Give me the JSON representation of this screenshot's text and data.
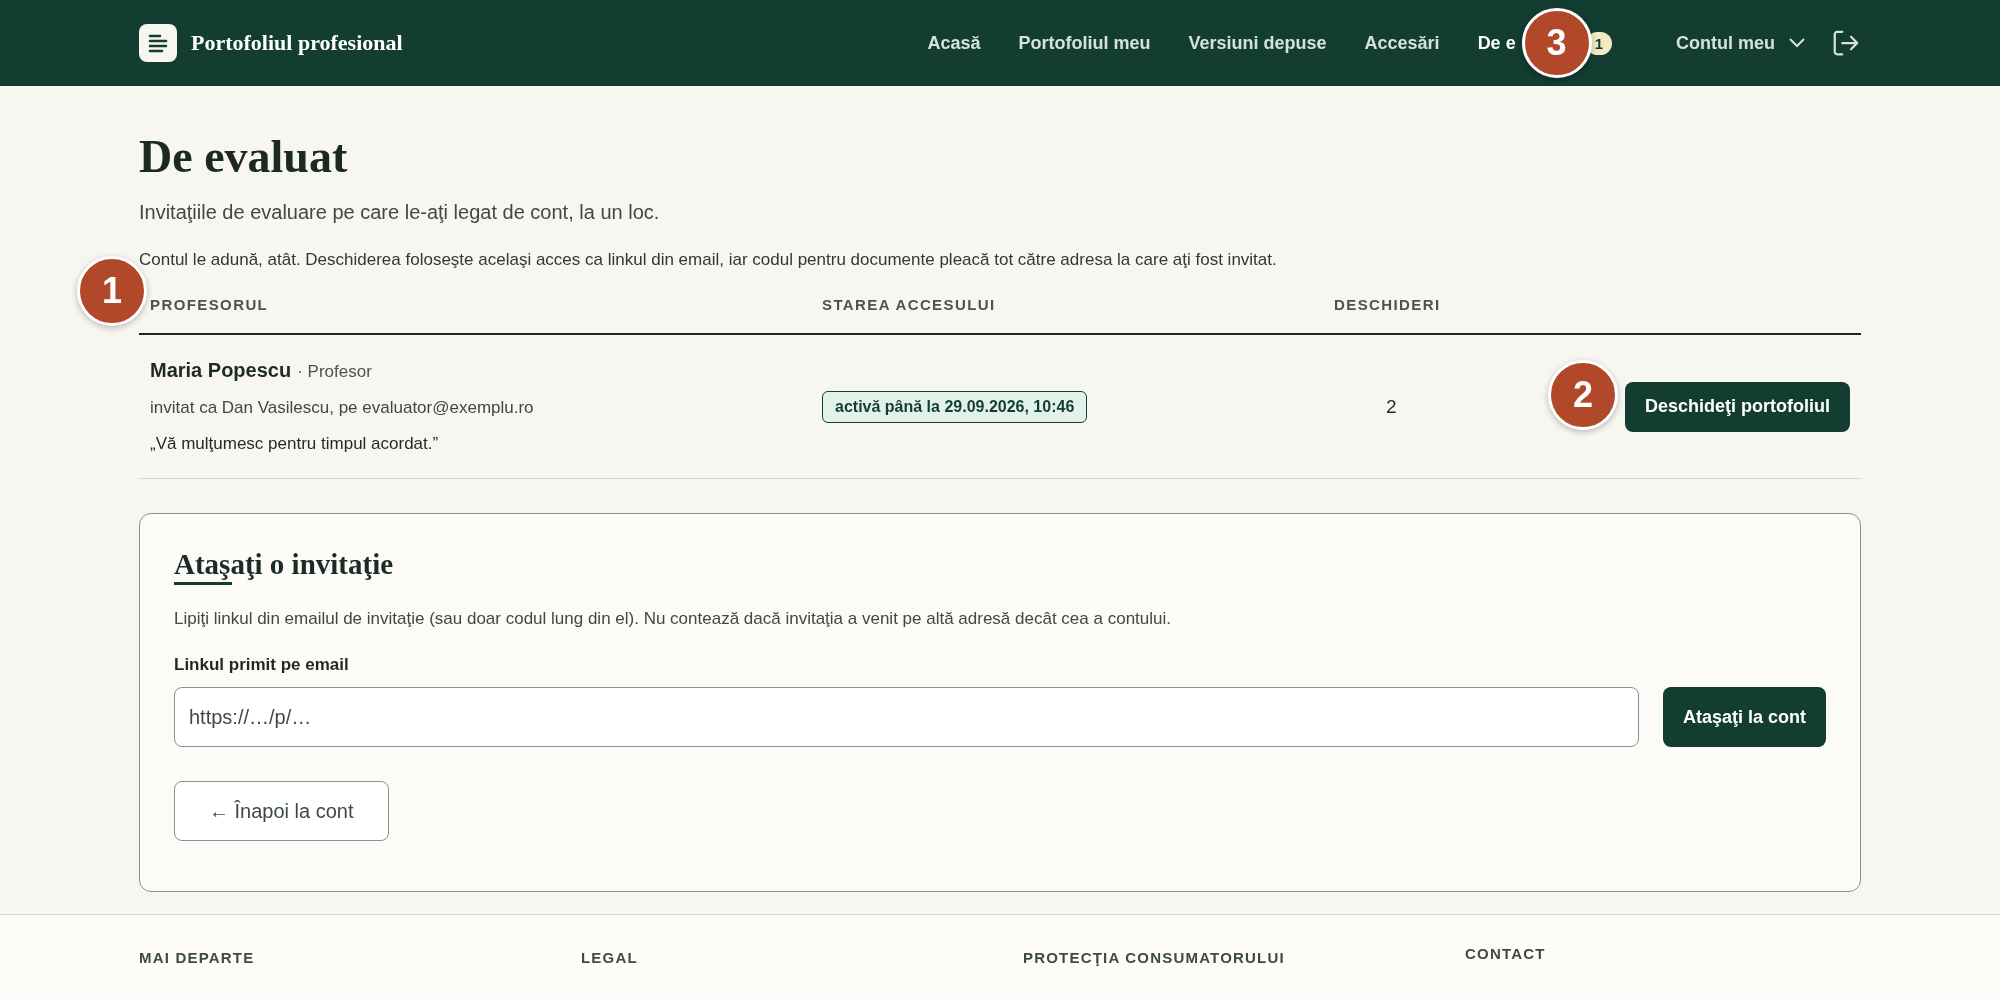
{
  "header": {
    "brand": "Portofoliul profesional",
    "nav": [
      {
        "label": "Acasă",
        "selected": false
      },
      {
        "label": "Portofoliul meu",
        "selected": false
      },
      {
        "label": "Versiuni depuse",
        "selected": false
      },
      {
        "label": "Accesări",
        "selected": false
      },
      {
        "label": "De e",
        "selected": true,
        "badge": "1"
      }
    ],
    "account": "Contul meu"
  },
  "page": {
    "title": "De evaluat",
    "subtitle": "Invitaţiile de evaluare pe care le-aţi legat de cont, la un loc.",
    "note": "Contul le adună, atât. Deschiderea foloseşte acelaşi acces ca linkul din email, iar codul pentru documente pleacă tot către adresa la care aţi fost invitat."
  },
  "table": {
    "columns": [
      "PROFESORUL",
      "STAREA ACCESULUI",
      "DESCHIDERI"
    ],
    "rows": [
      {
        "name": "Maria Popescu",
        "role": "· Profesor",
        "invited": "invitat ca Dan Vasilescu, pe evaluator@exemplu.ro",
        "message": "„Vă mulţumesc pentru timpul acordat.”",
        "status": "activă până la 29.09.2026, 10:46",
        "opens": "2",
        "action": "Deschideţi portofoliul"
      }
    ]
  },
  "attach": {
    "title": "Ataşaţi o invitaţie",
    "description": "Lipiţi linkul din emailul de invitaţie (sau doar codul lung din el). Nu contează dacă invitaţia a venit pe altă adresă decât cea a contului.",
    "label": "Linkul primit pe email",
    "placeholder": "https://…/p/…",
    "submit": "Ataşaţi la cont",
    "back": "← Înapoi la cont"
  },
  "footer": {
    "columns": [
      "MAI DEPARTE",
      "LEGAL",
      "PROTECŢIA CONSUMATORULUI",
      "CONTACT"
    ]
  },
  "annotations": [
    "1",
    "2",
    "3"
  ]
}
